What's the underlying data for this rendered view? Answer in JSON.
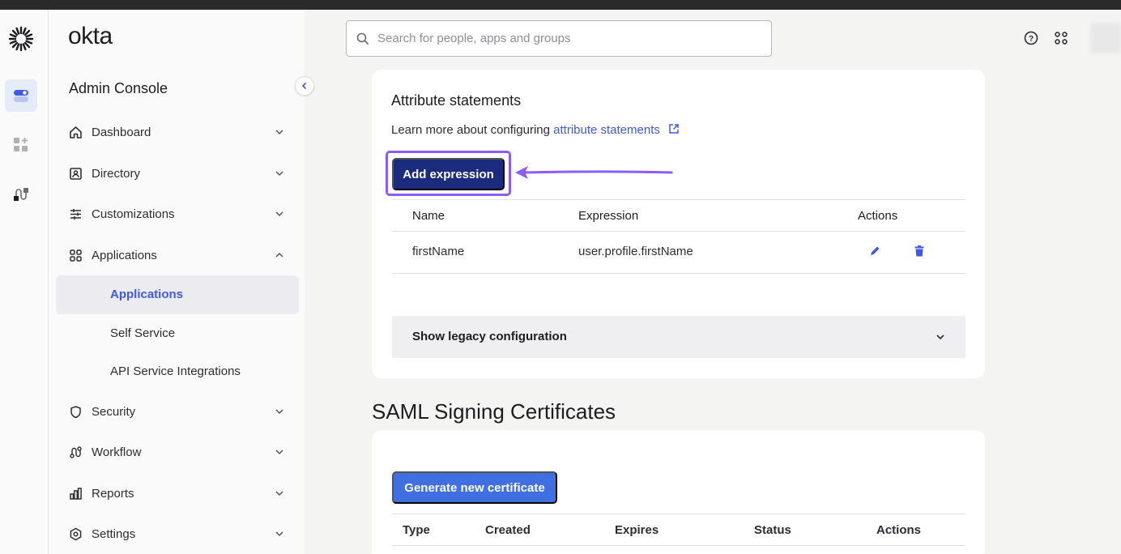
{
  "brand": "okta",
  "sidebar": {
    "console_title": "Admin Console",
    "items": [
      {
        "label": "Dashboard",
        "icon": "home-icon"
      },
      {
        "label": "Directory",
        "icon": "directory-icon"
      },
      {
        "label": "Customizations",
        "icon": "customizations-icon"
      },
      {
        "label": "Applications",
        "icon": "applications-icon"
      },
      {
        "label": "Security",
        "icon": "shield-icon"
      },
      {
        "label": "Workflow",
        "icon": "workflow-icon"
      },
      {
        "label": "Reports",
        "icon": "reports-icon"
      },
      {
        "label": "Settings",
        "icon": "gear-icon"
      }
    ],
    "sub_items": [
      {
        "label": "Applications"
      },
      {
        "label": "Self Service"
      },
      {
        "label": "API Service Integrations"
      }
    ]
  },
  "search": {
    "placeholder": "Search for people, apps and groups"
  },
  "attributes": {
    "title": "Attribute statements",
    "learn_prefix": "Learn more about configuring ",
    "learn_link": "attribute statements",
    "add_button": "Add expression",
    "columns": [
      "Name",
      "Expression",
      "Actions"
    ],
    "rows": [
      {
        "name": "firstName",
        "expression": "user.profile.firstName"
      }
    ],
    "legacy": "Show legacy configuration"
  },
  "saml": {
    "title": "SAML Signing Certificates",
    "generate_button": "Generate new certificate",
    "columns": [
      "Type",
      "Created",
      "Expires",
      "Status",
      "Actions"
    ]
  },
  "colors": {
    "accent": "#3f59e4",
    "primary_dark": "#1b2c7e",
    "highlight": "#8c5cf5"
  }
}
